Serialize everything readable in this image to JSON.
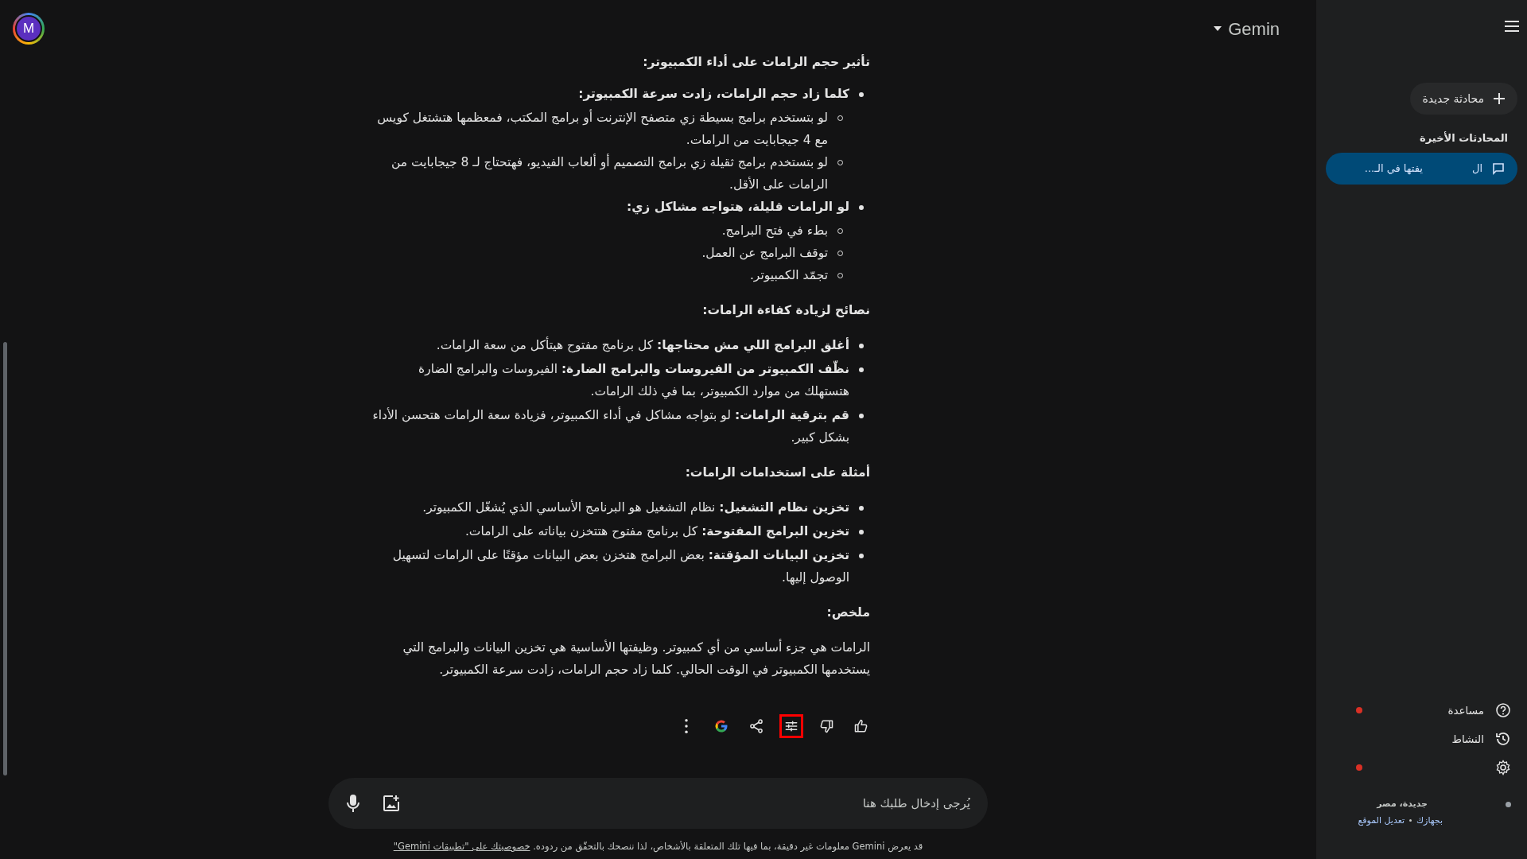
{
  "header": {
    "avatar_letter": "M",
    "title": "Gemin"
  },
  "response": [
    {
      "kind": "heading",
      "text": "تأثير حجم الرامات على أداء الكمبيوتر:"
    },
    {
      "kind": "bullets",
      "items": [
        {
          "text": "**كلما زاد حجم الرامات، زادت سرعة الكمبيوتر:**",
          "children": [
            {
              "text": "لو بتستخدم برامج بسيطة زي متصفح الإنترنت أو برامج المكتب، فمعظمها هتشتغل كويس مع 4 جيجابايت من الرامات."
            },
            {
              "text": "لو بتستخدم برامج ثقيلة زي برامج التصميم أو ألعاب الفيديو، فهتحتاج لـ 8 جيجابايت من الرامات على الأقل."
            }
          ]
        },
        {
          "text": "**لو الرامات قليلة، هتواجه مشاكل زي:**",
          "children": [
            {
              "text": "بطء في فتح البرامج."
            },
            {
              "text": "توقف البرامج عن العمل."
            },
            {
              "text": "تجمّد الكمبيوتر."
            }
          ]
        }
      ]
    },
    {
      "kind": "heading",
      "text": "نصائح لزيادة كفاءة الرامات:"
    },
    {
      "kind": "bullets",
      "items": [
        {
          "text": "**أغلق البرامج اللي مش محتاجها:** كل برنامج مفتوح هيتأكل من سعة الرامات."
        },
        {
          "text": "**نظّف الكمبيوتر من الفيروسات والبرامج الضارة:** الفيروسات والبرامج الضارة هتستهلك من موارد الكمبيوتر، بما في ذلك الرامات."
        },
        {
          "text": "**قم بترقية الرامات:** لو بتواجه مشاكل في أداء الكمبيوتر، فزيادة سعة الرامات هتحسن الأداء بشكل كبير."
        }
      ]
    },
    {
      "kind": "heading",
      "text": "أمثلة على استخدامات الرامات:"
    },
    {
      "kind": "bullets",
      "items": [
        {
          "text": "**تخزين نظام التشغيل:** نظام التشغيل هو البرنامج الأساسي الذي يُشغّل الكمبيوتر."
        },
        {
          "text": "**تخزين البرامج المفتوحة:** كل برنامج مفتوح هتتخزن بياناته على الرامات."
        },
        {
          "text": "**تخزين البيانات المؤقتة:** بعض البرامج هتخزن بعض البيانات مؤقتًا على الرامات لتسهيل الوصول إليها."
        }
      ]
    },
    {
      "kind": "heading",
      "text": "ملخص:"
    },
    {
      "kind": "paragraph",
      "text": "الرامات هي جزء أساسي من أي كمبيوتر. وظيفتها الأساسية هي تخزين البيانات والبرامج التي يستخدمها الكمبيوتر في الوقت الحالي. كلما زاد حجم الرامات، زادت سرعة الكمبيوتر."
    }
  ],
  "actions": [
    {
      "kind": "thumbs_up",
      "highlighted": false
    },
    {
      "kind": "thumbs_down",
      "highlighted": false
    },
    {
      "kind": "tune",
      "highlighted": true
    },
    {
      "kind": "share",
      "highlighted": false
    },
    {
      "kind": "google",
      "highlighted": false
    },
    {
      "kind": "more",
      "highlighted": false
    }
  ],
  "input": {
    "placeholder": "يُرجى إدخال طلبك هنا"
  },
  "disclaimer": {
    "text": "قد يعرض Gemini معلومات غير دقيقة، بما فيها تلك المتعلقة بالأشخاص، لذا ننصحك بالتحقّق من ردوده.",
    "link": "خصوصيتك على \"تطبيقات Gemini\""
  },
  "sidebar": {
    "new_chat": "محادثة جديدة",
    "recent_heading": "المحادثات الأخيرة",
    "recent": [
      {
        "title_start": "ال",
        "title_end": "يفتها في الـ...",
        "selected": true
      }
    ],
    "footer": [
      {
        "kind": "help",
        "label": "مساعدة",
        "dot": true
      },
      {
        "kind": "activity",
        "label": "النشاط",
        "dot": false
      },
      {
        "kind": "settings",
        "dot": true
      }
    ],
    "location": {
      "place": "جديدة، مصر",
      "source": "بجهازك",
      "link": "تعديل الموقع"
    }
  }
}
